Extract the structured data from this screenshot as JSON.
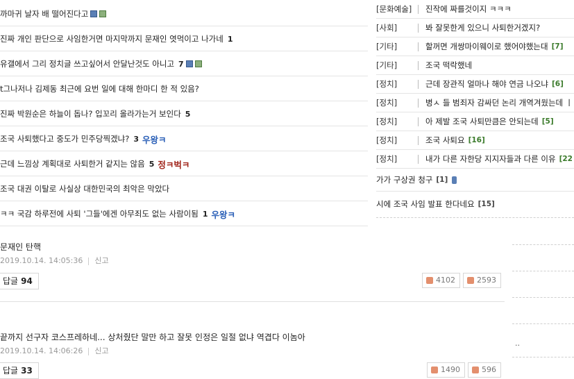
{
  "left_posts": [
    {
      "text": "까마귀 날자 배 떨어진다고",
      "count": "",
      "nick": "",
      "icons": [
        "save",
        "img"
      ]
    },
    {
      "text": "진짜 개인 판단으로 사임한거면 마지막까지 문재인 엿먹이고 나가네",
      "count": "1",
      "nick": "",
      "icons": []
    },
    {
      "text": "유갤에서 그리 정치글 쓰고싶어서 안달난것도 아니고",
      "count": "7",
      "nick": "",
      "icons": [
        "save",
        "img"
      ]
    },
    {
      "text": "t그나저나 김제동 최근에 요번 일에 대해 한마디 한 적 있음?",
      "count": "",
      "nick": "",
      "icons": []
    },
    {
      "text": "진짜 박원순은 하늘이 돕나? 입꼬리 올라가는거 보인다",
      "count": "5",
      "nick": "",
      "icons": []
    },
    {
      "text": "조국 사퇴했다고 중도가 민주당찍겠냐?",
      "count": "3",
      "nick": "우왕ㅋ",
      "nick_color": "blue",
      "icons": []
    },
    {
      "text": "근데 느낌상 계획대로 사퇴한거 같지는 않음",
      "count": "5",
      "nick": "정ㅋ벅ㅋ",
      "nick_color": "red",
      "icons": []
    },
    {
      "text": "조국 대권 이탈로 사실상 대한민국의 최악은 막았다",
      "count": "",
      "nick": "",
      "icons": []
    },
    {
      "text": "ㅋㅋ 국감 하루전에 사퇴 '그들'에겐 아무죄도 없는 사람이됨",
      "count": "1",
      "nick": "우왕ㅋ",
      "nick_color": "blue",
      "icons": []
    }
  ],
  "right_posts": [
    {
      "category": "[문화예술]",
      "title": "진작에 짜를것이지 ㅋㅋㅋ",
      "count": ""
    },
    {
      "category": "[사회]",
      "title": "봐 잘못한게 있으니 사퇴한거겠지?",
      "count": ""
    },
    {
      "category": "[기타]",
      "title": "할꺼면 개쌍마이웨이로 했어야했는대",
      "count": "[7]"
    },
    {
      "category": "[기타]",
      "title": "조국 떡락했네",
      "count": ""
    },
    {
      "category": "[정치]",
      "title": "근데 장관직 얼마나 해야 연금 나오냐",
      "count": "[6]"
    },
    {
      "category": "[정치]",
      "title": "병ㅅ 들 범죄자 감싸던 논리 개역겨웠는데 ㅣ",
      "count": ""
    },
    {
      "category": "[정치]",
      "title": "아 제발 조국 사퇴만큼은 안되는데",
      "count": "[5]"
    },
    {
      "category": "[정치]",
      "title": "조국 사퇴요",
      "count": "[16]"
    },
    {
      "category": "[정치]",
      "title": "내가 다른 자한당 지지자들과 다른 이유",
      "count": "[22"
    }
  ],
  "right_extra": [
    {
      "title": "가가 구상권 청구",
      "count": "[1]"
    },
    {
      "title": "시에 조국 사임 발표 한다네요",
      "count": "[15]"
    }
  ],
  "right_dots": "..",
  "comments": [
    {
      "text": "문재인 탄핵",
      "datetime": "2019.10.14. 14:05:36",
      "report": "신고",
      "reply_label": "답글",
      "reply_count": "94",
      "up": "4102",
      "down": "2593"
    },
    {
      "text": "끝까지 선구자 코스프레하네... 상처줬단 말만 하고 잘못 인정은 일절 없냐 역겹다 이놈아",
      "datetime": "2019.10.14. 14:06:26",
      "report": "신고",
      "reply_label": "답글",
      "reply_count": "33",
      "up": "1490",
      "down": "596"
    }
  ]
}
